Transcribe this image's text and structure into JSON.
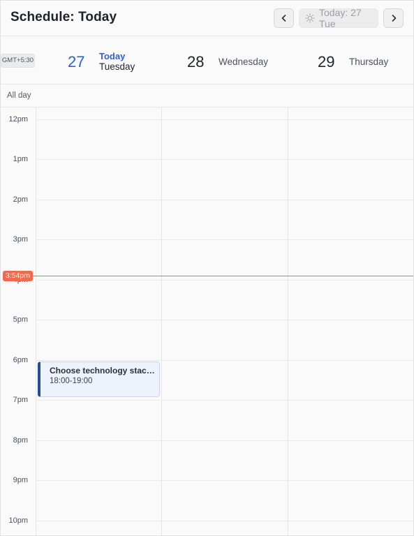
{
  "header": {
    "title": "Schedule: Today",
    "prev_icon": "chevron-left-icon",
    "next_icon": "chevron-right-icon",
    "today_icon": "sun-icon",
    "today_button_label": "Today: 27 Tue"
  },
  "timezone": "GMT+5:30",
  "days": [
    {
      "number": "27",
      "today_label": "Today",
      "weekday": "Tuesday",
      "is_today": true
    },
    {
      "number": "28",
      "weekday": "Wednesday",
      "is_today": false
    },
    {
      "number": "29",
      "weekday": "Thursday",
      "is_today": false
    }
  ],
  "all_day_label": "All day",
  "hours": [
    "12pm",
    "1pm",
    "2pm",
    "3pm",
    "4pm",
    "5pm",
    "6pm",
    "7pm",
    "8pm",
    "9pm",
    "10pm"
  ],
  "now_indicator": "3:54pm",
  "events": [
    {
      "title": "Choose technology stack for the project",
      "time": "18:00-19:00",
      "day": "Tuesday"
    }
  ],
  "colors": {
    "accent": "#2f5fd0",
    "now_line": "#ef6a4f",
    "event_border": "#254d96",
    "event_bg": "#eef3fb"
  }
}
